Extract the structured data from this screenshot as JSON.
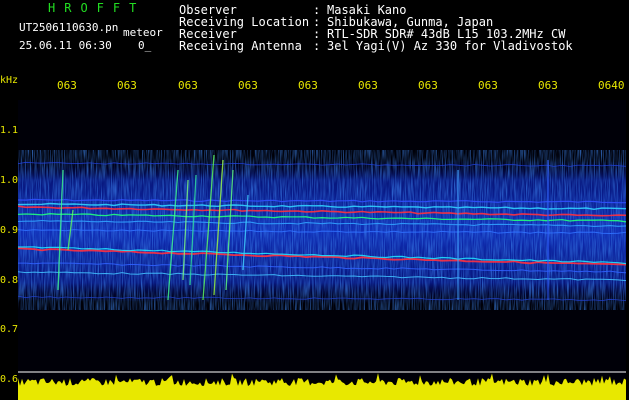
{
  "app": {
    "name": "HROFFT",
    "filename": "UT2506110630.pn",
    "product": "meteor",
    "datetime": "25.06.11 06:30",
    "counter": "0_"
  },
  "header": {
    "rows": [
      {
        "label": "Observer",
        "value": "Masaki Kano"
      },
      {
        "label": "Receiving Location",
        "value": "Shibukawa, Gunma, Japan"
      },
      {
        "label": "Receiver",
        "value": "RTL-SDR SDR# 43dB L15 103.2MHz CW"
      },
      {
        "label": "Receiving Antenna",
        "value": "3el Yagi(V) Az 330 for Vladivostok"
      }
    ]
  },
  "plot": {
    "y_unit": "kHz",
    "y_ticks": [
      "1.1",
      "1.0",
      "0.9",
      "0.8",
      "0.7",
      "0.6"
    ],
    "x_ticks": [
      "063",
      "063",
      "063",
      "063",
      "063",
      "063",
      "063",
      "063",
      "063",
      "0640"
    ],
    "colors": {
      "background": "#000000",
      "axis_text": "#e8e800",
      "baseline": "#ffffff"
    }
  }
}
